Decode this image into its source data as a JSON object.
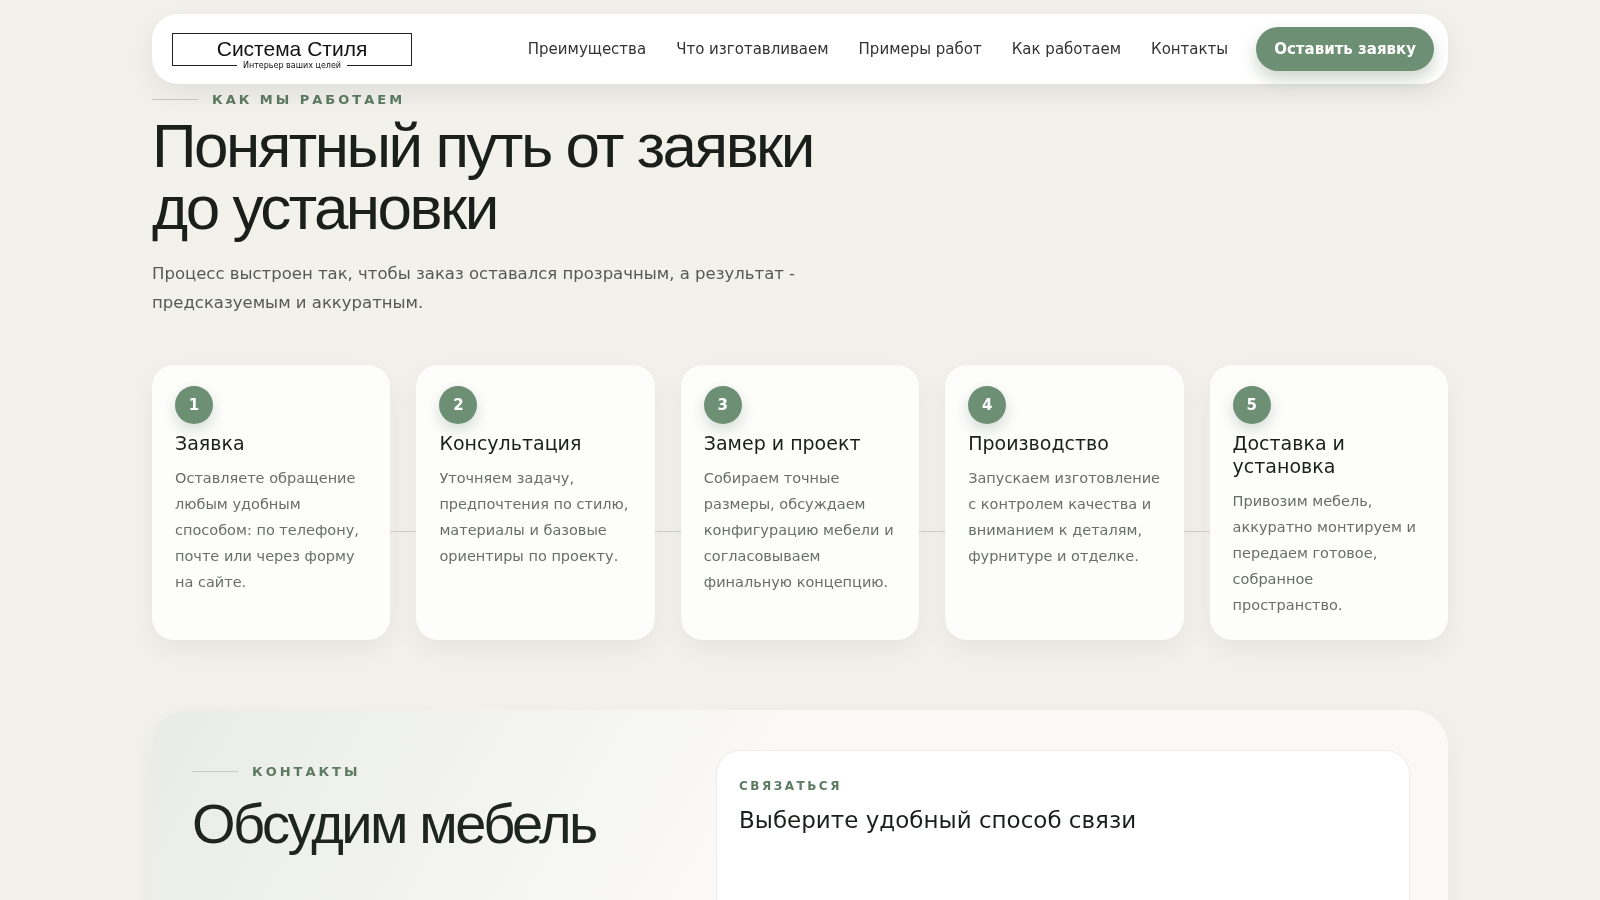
{
  "header": {
    "logo": {
      "title": "Система Стиля",
      "tagline": "Интерьер ваших целей"
    },
    "nav": [
      {
        "label": "Преимущества"
      },
      {
        "label": "Что изготавливаем"
      },
      {
        "label": "Примеры работ"
      },
      {
        "label": "Как работаем"
      },
      {
        "label": "Контакты"
      }
    ],
    "cta": "Оставить заявку"
  },
  "process": {
    "eyebrow": "КАК МЫ РАБОТАЕМ",
    "title": "Понятный путь от заявки до установки",
    "lead": "Процесс выстроен так, чтобы заказ оставался прозрачным, а результат - предсказуемым и аккуратным.",
    "steps": [
      {
        "number": "1",
        "title": "Заявка",
        "text": "Оставляете обращение любым удобным способом: по телефону, почте или через форму на сайте."
      },
      {
        "number": "2",
        "title": "Консультация",
        "text": "Уточняем задачу, предпочтения по стилю, материалы и базовые ориентиры по проекту."
      },
      {
        "number": "3",
        "title": "Замер и проект",
        "text": "Собираем точные размеры, обсуждаем конфигурацию мебели и согласовываем финальную концепцию."
      },
      {
        "number": "4",
        "title": "Производство",
        "text": "Запускаем изготовление с контролем качества и вниманием к деталям, фурнитуре и отделке."
      },
      {
        "number": "5",
        "title": "Доставка и установка",
        "text": "Привозим мебель, аккуратно монтируем и передаем готовое, собранное пространство."
      }
    ]
  },
  "contacts": {
    "eyebrow": "КОНТАКТЫ",
    "title": "Обсудим мебель",
    "panel": {
      "eyebrow": "СВЯЗАТЬСЯ",
      "title": "Выберите удобный способ связи"
    }
  }
}
